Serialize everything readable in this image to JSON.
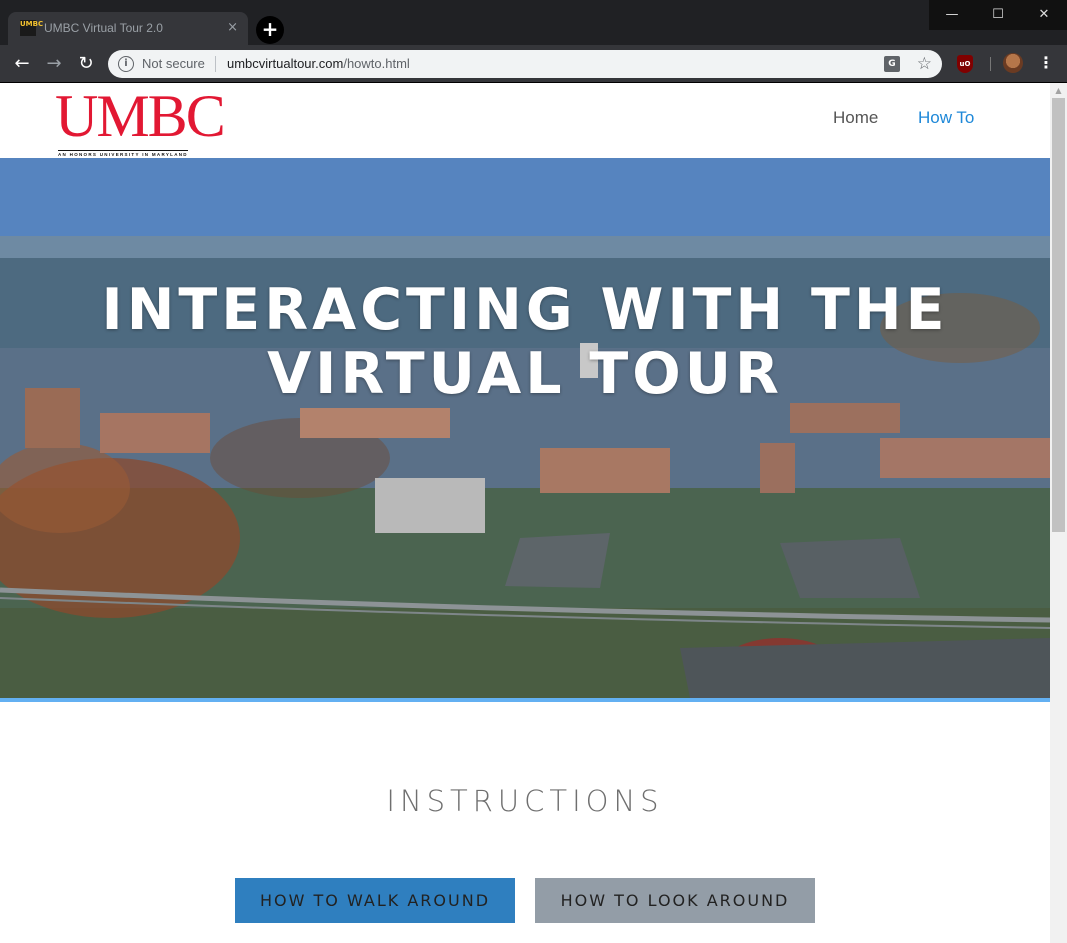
{
  "browser": {
    "tab_title": "UMBC Virtual Tour 2.0",
    "tab_favicon_text": "UMBC",
    "tab_close": "×",
    "new_tab": "+",
    "window_controls": {
      "minimize": "—",
      "maximize": "☐",
      "close": "✕"
    },
    "back": "←",
    "forward": "→",
    "reload": "↻",
    "security_label": "Not secure",
    "url_host": "umbcvirtualtour.com",
    "url_path": "/howto.html",
    "menu": "⋮",
    "ublock_text": "uO",
    "translate_text": "G",
    "bookmark": "☆"
  },
  "header": {
    "logo_text": "UMBC",
    "logo_tagline": "AN HONORS UNIVERSITY IN MARYLAND",
    "nav": [
      {
        "label": "Home",
        "active": false
      },
      {
        "label": "How To",
        "active": true
      }
    ]
  },
  "hero": {
    "title_line1": "INTERACTING WITH THE",
    "title_line2": "VIRTUAL TOUR",
    "accent_color": "#63b0f2"
  },
  "instructions": {
    "heading": "INSTRUCTIONS",
    "buttons": [
      {
        "label": "HOW TO WALK AROUND",
        "color": "#2f7fbf"
      },
      {
        "label": "HOW TO LOOK AROUND",
        "color": "#939da7"
      }
    ]
  },
  "colors": {
    "brand_red": "#e21833",
    "link_active": "#1e88d8"
  }
}
